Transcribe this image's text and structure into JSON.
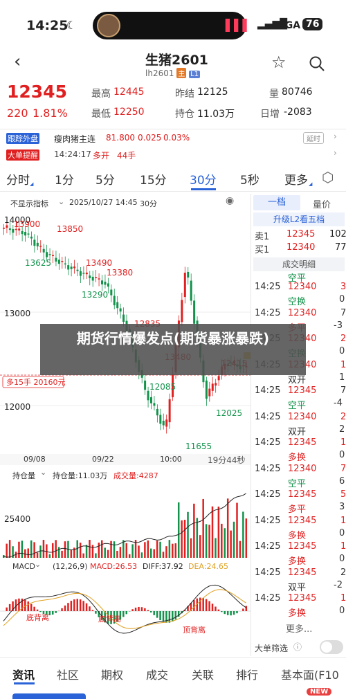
{
  "status": {
    "time": "14:25",
    "network": "5GA",
    "battery": "76"
  },
  "header": {
    "title": "生猪2601",
    "code": "lh2601",
    "tag_main": "主",
    "tag_l1": "L1"
  },
  "quote": {
    "price": "12345",
    "change": "220",
    "change_pct": "1.81%",
    "high_label": "最高",
    "high": "12445",
    "low_label": "最低",
    "low": "12250",
    "prev_label": "昨结",
    "prev": "12125",
    "oi_label": "持仓",
    "oi": "11.03万",
    "vol_label": "量",
    "vol": "80746",
    "day_inc_label": "日增",
    "day_inc": "-2083"
  },
  "news": [
    {
      "tag": "跟踪外盘",
      "text": "瘦肉猪主连",
      "price": "81.800",
      "chg": "0.025",
      "pct": "0.03%",
      "delay": "延时"
    },
    {
      "tag": "大单提醒",
      "time": "14:24:17",
      "text": "多开",
      "lots": "44手"
    }
  ],
  "tabs": [
    "分时",
    "1分",
    "5分",
    "15分",
    "30分",
    "5秒",
    "更多"
  ],
  "chart_toolbar": {
    "indicator": "不显示指标",
    "datetime": "2025/10/27 14:45",
    "period": "30分"
  },
  "price_chart": {
    "y_ticks": [
      "14000",
      "13000",
      "12000"
    ],
    "annotations": [
      "13900",
      "13850",
      "13625",
      "13490",
      "13380",
      "13290",
      "12835",
      "13480",
      "12415",
      "12085",
      "12025",
      "11655"
    ],
    "position_label": "多15手 20160元",
    "x_ticks": [
      "09/08",
      "09/22",
      "10:00"
    ],
    "countdown": "19分44秒"
  },
  "oi_chart": {
    "label": "持仓量",
    "oi_text": "持仓量:11.03万",
    "vol_text": "成交量:4287",
    "y_tick": "25400"
  },
  "macd": {
    "label": "MACD",
    "params": "(12,26,9)",
    "macd": "MACD:26.53",
    "diff": "DIFF:37.92",
    "dea": "DEA:24.65",
    "divergence": [
      "底背离",
      "底背离",
      "顶背离",
      "底背离"
    ]
  },
  "chart_data": {
    "type": "line",
    "title": "",
    "xlabel": "",
    "ylabel": "",
    "x": [
      "09/08",
      "09/22",
      "10:00"
    ],
    "ylim": [
      11500,
      14000
    ],
    "series": [
      {
        "values": [
          13900,
          13850,
          13625,
          13490,
          13380,
          13290,
          12835,
          12085,
          11655,
          13480,
          12025,
          12415,
          12345
        ]
      }
    ]
  },
  "right_panel": {
    "tab_level1": "一档",
    "tab_quantity": "量价",
    "upgrade": "升级L2看五档",
    "ask_label": "卖1",
    "ask_price": "12345",
    "ask_vol": "102",
    "bid_label": "买1",
    "bid_price": "12340",
    "bid_vol": "77",
    "trades_title": "成交明细",
    "first_type": "空平",
    "trades": [
      {
        "time": "14:25",
        "price": "12340",
        "type": "空换",
        "vol": "3",
        "vol2": "0"
      },
      {
        "time": "14:25",
        "price": "12340",
        "type": "多平",
        "vol": "7",
        "vol2": "-3"
      },
      {
        "time": "14:25",
        "price": "12340",
        "type": "空换",
        "vol": "2",
        "vol2": "0"
      },
      {
        "time": "14:25",
        "price": "12340",
        "type": "双开",
        "vol": "1",
        "vol2": "1"
      },
      {
        "time": "14:25",
        "price": "12345",
        "type": "空平",
        "vol": "7",
        "vol2": "-4"
      },
      {
        "time": "14:25",
        "price": "12340",
        "type": "双开",
        "vol": "2",
        "vol2": "2"
      },
      {
        "time": "14:25",
        "price": "12345",
        "type": "多换",
        "vol": "1",
        "vol2": "0"
      },
      {
        "time": "14:25",
        "price": "12340",
        "type": "空平",
        "vol": "7",
        "vol2": "6"
      },
      {
        "time": "14:25",
        "price": "12345",
        "type": "多平",
        "vol": "5",
        "vol2": "3"
      },
      {
        "time": "14:25",
        "price": "12345",
        "type": "多换",
        "vol": "1",
        "vol2": "0"
      },
      {
        "time": "14:25",
        "price": "12345",
        "type": "多换",
        "vol": "1",
        "vol2": "0"
      },
      {
        "time": "14:25",
        "price": "12345",
        "type": "双平",
        "vol": "2",
        "vol2": "-2"
      },
      {
        "time": "14:25",
        "price": "12345",
        "type": "多换",
        "vol": "1",
        "vol2": "0"
      }
    ],
    "more": "更多...",
    "filter": "大单筛选"
  },
  "overlay_title": "期货行情爆发点(期货暴涨暴跌)",
  "bottom_nav": [
    "资讯",
    "社区",
    "期权",
    "成交",
    "关联",
    "排行",
    "基本面(F10"
  ],
  "badge_new": "NEW",
  "colors": {
    "up": "#e02020",
    "down": "#12924a",
    "accent": "#2a62d8"
  }
}
